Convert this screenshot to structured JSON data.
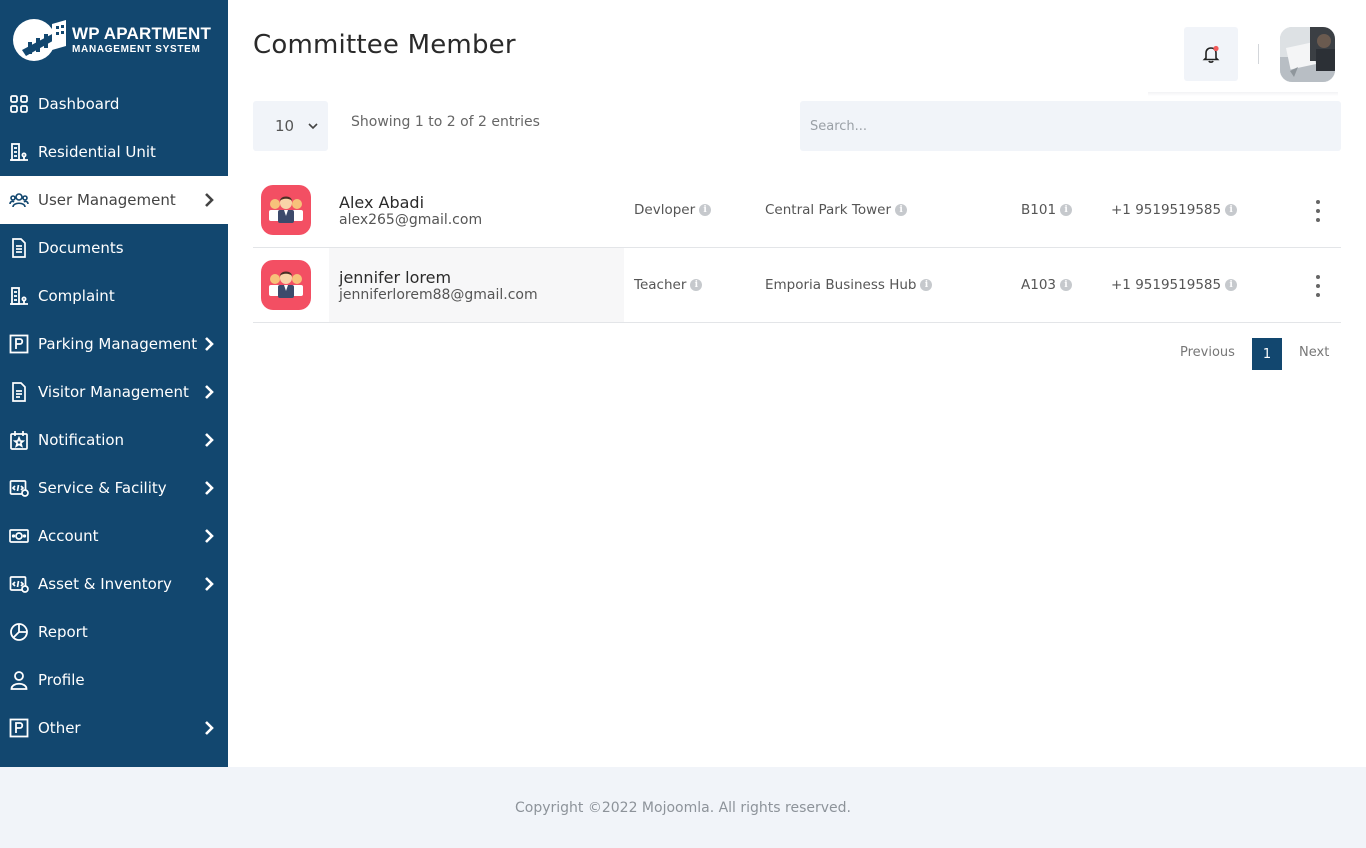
{
  "brand": {
    "title": "WP APARTMENT",
    "subtitle": "MANAGEMENT SYSTEM"
  },
  "sidebar": {
    "items": [
      {
        "label": "Dashboard",
        "icon": "grid-icon",
        "has_submenu": false,
        "active": false
      },
      {
        "label": "Residential Unit",
        "icon": "building-icon",
        "has_submenu": false,
        "active": false
      },
      {
        "label": "User Management",
        "icon": "users-icon",
        "has_submenu": true,
        "active": true
      },
      {
        "label": "Documents",
        "icon": "document-icon",
        "has_submenu": false,
        "active": false
      },
      {
        "label": "Complaint",
        "icon": "building-icon",
        "has_submenu": false,
        "active": false
      },
      {
        "label": "Parking Management",
        "icon": "parking-icon",
        "has_submenu": true,
        "active": false
      },
      {
        "label": "Visitor Management",
        "icon": "file-icon",
        "has_submenu": true,
        "active": false
      },
      {
        "label": "Notification",
        "icon": "calendar-star-icon",
        "has_submenu": true,
        "active": false
      },
      {
        "label": "Service & Facility",
        "icon": "service-icon",
        "has_submenu": true,
        "active": false
      },
      {
        "label": "Account",
        "icon": "money-icon",
        "has_submenu": true,
        "active": false
      },
      {
        "label": "Asset & Inventory",
        "icon": "service-icon",
        "has_submenu": true,
        "active": false
      },
      {
        "label": "Report",
        "icon": "pie-chart-icon",
        "has_submenu": false,
        "active": false
      },
      {
        "label": "Profile",
        "icon": "user-icon",
        "has_submenu": false,
        "active": false
      },
      {
        "label": "Other",
        "icon": "parking-icon",
        "has_submenu": true,
        "active": false
      }
    ]
  },
  "header": {
    "title": "Committee Member"
  },
  "table_controls": {
    "page_length": "10",
    "info": "Showing 1 to 2 of 2 entries",
    "search_placeholder": "Search..."
  },
  "members": [
    {
      "name": "Alex Abadi",
      "email": "alex265@gmail.com",
      "designation": "Devloper",
      "building": "Central Park Tower",
      "unit": "B101",
      "phone": "+1 9519519585"
    },
    {
      "name": "jennifer lorem",
      "email": "jenniferlorem88@gmail.com",
      "designation": "Teacher",
      "building": "Emporia Business Hub",
      "unit": "A103",
      "phone": "+1 9519519585"
    }
  ],
  "pagination": {
    "previous": "Previous",
    "current": "1",
    "next": "Next"
  },
  "footer": {
    "text": "Copyright ©2022 Mojoomla. All rights reserved."
  },
  "colors": {
    "sidebar_bg": "#12476f",
    "accent": "#12476f",
    "avatar_bg": "#f34f63",
    "notification_dot": "#f25a5a"
  }
}
